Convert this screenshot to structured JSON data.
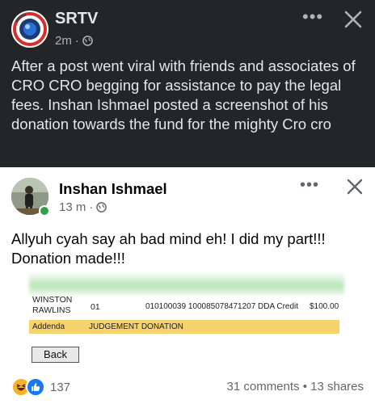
{
  "outer_post": {
    "author": "SRTV",
    "time": "2m",
    "separator": "·",
    "more_label": "•••",
    "text": "After a post went viral with friends and associates of CRO CRO begging for assistance to pay the legal fees. Inshan Ishmael posted a screenshot of his donation towards  the fund for the mighty Cro cro"
  },
  "inner_post": {
    "author": "Inshan Ishmael",
    "time": "13 m",
    "separator": "·",
    "more_label": "•••",
    "text": "Allyuh cyah say ah bad mind eh! I did my part!!! Donation made!!!",
    "bank": {
      "name": "WINSTON RAWLINS",
      "code": "01",
      "reference": "010100039 100085078471207 DDA Credit",
      "amount": "$100.00",
      "addenda_label": "Addenda",
      "addenda_value": "JUDGEMENT DONATION",
      "back_label": "Back"
    },
    "reactions_count": "137",
    "stats": "31 comments • 13 shares"
  },
  "colors": {
    "dark_bg": "#242526",
    "online": "#31a24c",
    "like": "#1877f2",
    "addenda": "#f7d36e"
  }
}
